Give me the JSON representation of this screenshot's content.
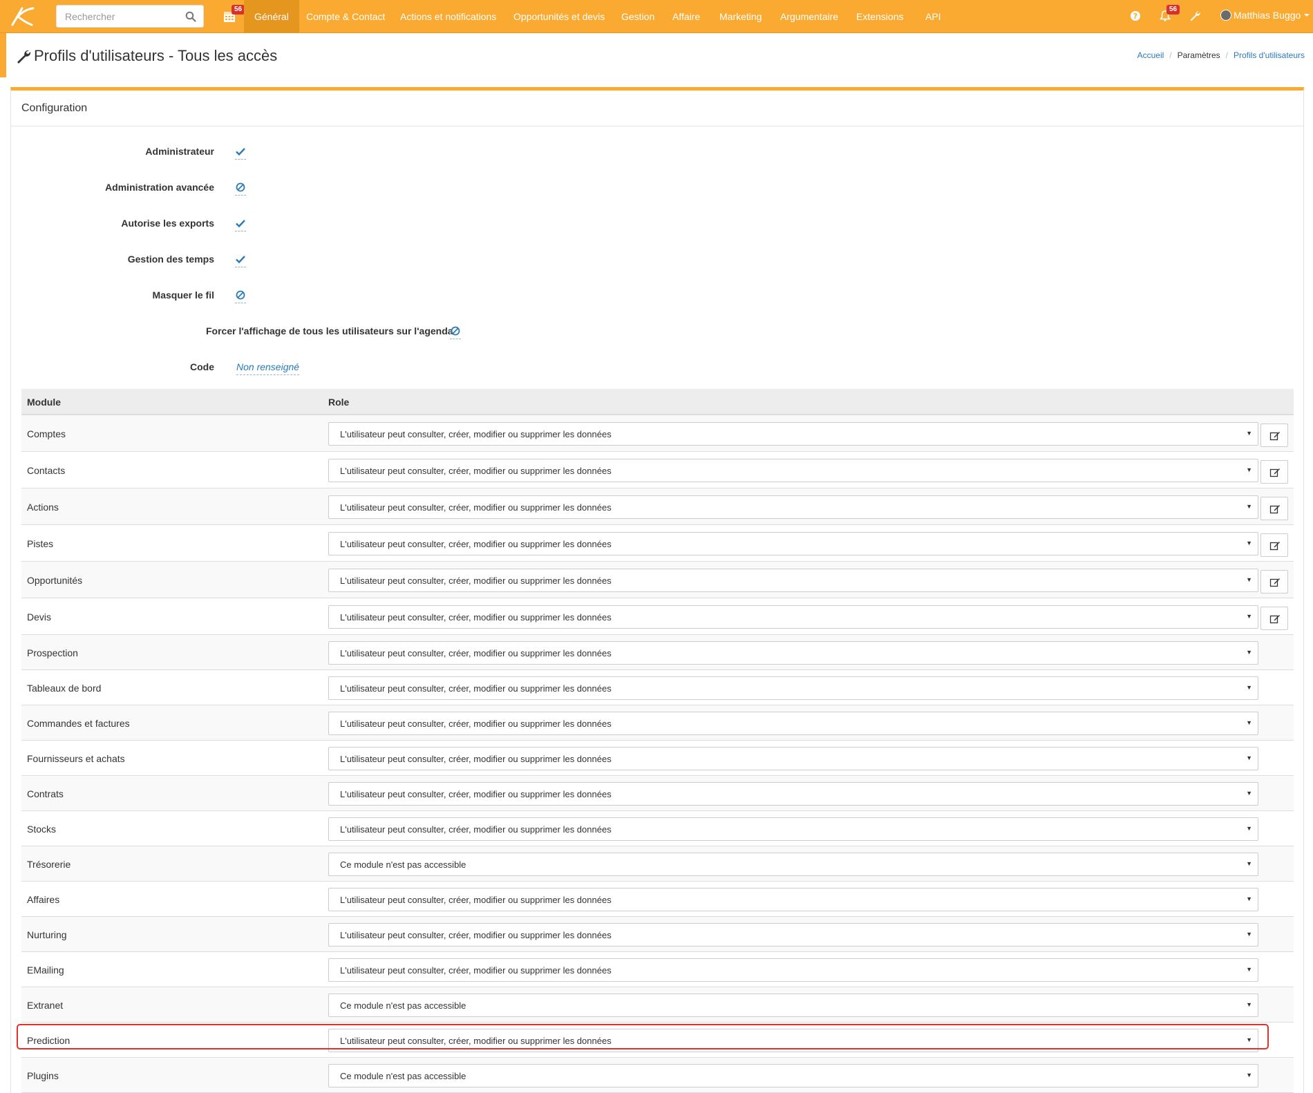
{
  "search": {
    "placeholder": "Rechercher"
  },
  "topbar": {
    "calendar_badge": "56",
    "notifications_badge": "56",
    "nav": [
      {
        "label": "Général",
        "active": true
      },
      {
        "label": "Compte & Contact"
      },
      {
        "label": "Actions et notifications"
      },
      {
        "label": "Opportunités et devis"
      },
      {
        "label": "Gestion"
      },
      {
        "label": "Affaire"
      },
      {
        "label": "Marketing"
      },
      {
        "label": "Argumentaire"
      },
      {
        "label": "Extensions"
      },
      {
        "label": "API"
      }
    ],
    "user_name": "Matthias Buggo"
  },
  "page": {
    "title": "Profils d'utilisateurs - Tous les accès",
    "breadcrumb": [
      "Accueil",
      "Paramètres",
      "Profils d'utilisateurs"
    ]
  },
  "panel": {
    "title": "Configuration",
    "settings": [
      {
        "label": "Administrateur",
        "value": "check-icon"
      },
      {
        "label": "Administration avancée",
        "value": "ban-icon"
      },
      {
        "label": "Autorise les exports",
        "value": "check-icon"
      },
      {
        "label": "Gestion des temps",
        "value": "check-icon"
      },
      {
        "label": "Masquer le fil",
        "value": "ban-icon"
      },
      {
        "label": "Forcer l'affichage de tous les utilisateurs sur l'agenda",
        "value": "ban-icon"
      },
      {
        "label": "Code",
        "value": "Non renseigné"
      }
    ]
  },
  "table": {
    "headers": [
      "Module",
      "Role"
    ],
    "rows": [
      {
        "module": "Comptes",
        "role": "L'utilisateur peut consulter, créer, modifier ou supprimer les données"
      },
      {
        "module": "Contacts",
        "role": "L'utilisateur peut consulter, créer, modifier ou supprimer les données"
      },
      {
        "module": "Actions",
        "role": "L'utilisateur peut consulter, créer, modifier ou supprimer les données"
      },
      {
        "module": "Pistes",
        "role": "L'utilisateur peut consulter, créer, modifier ou supprimer les données"
      },
      {
        "module": "Opportunités",
        "role": "L'utilisateur peut consulter, créer, modifier ou supprimer les données"
      },
      {
        "module": "Devis",
        "role": "L'utilisateur peut consulter, créer, modifier ou supprimer les données"
      },
      {
        "module": "Prospection",
        "role": "L'utilisateur peut consulter, créer, modifier ou supprimer les données"
      },
      {
        "module": "Tableaux de bord",
        "role": "L'utilisateur peut consulter, créer, modifier ou supprimer les données"
      },
      {
        "module": "Commandes et factures",
        "role": "L'utilisateur peut consulter, créer, modifier ou supprimer les données"
      },
      {
        "module": "Fournisseurs et achats",
        "role": "L'utilisateur peut consulter, créer, modifier ou supprimer les données"
      },
      {
        "module": "Contrats",
        "role": "L'utilisateur peut consulter, créer, modifier ou supprimer les données"
      },
      {
        "module": "Stocks",
        "role": "L'utilisateur peut consulter, créer, modifier ou supprimer les données"
      },
      {
        "module": "Trésorerie",
        "role": "Ce module n'est pas accessible"
      },
      {
        "module": "Affaires",
        "role": "L'utilisateur peut consulter, créer, modifier ou supprimer les données"
      },
      {
        "module": "Nurturing",
        "role": "L'utilisateur peut consulter, créer, modifier ou supprimer les données"
      },
      {
        "module": "EMailing",
        "role": "L'utilisateur peut consulter, créer, modifier ou supprimer les données"
      },
      {
        "module": "Extranet",
        "role": "Ce module n'est pas accessible"
      },
      {
        "module": "Prediction",
        "role": "L'utilisateur peut consulter, créer, modifier ou supprimer les données"
      },
      {
        "module": "Plugins",
        "role": "Ce module n'est pas accessible"
      }
    ]
  },
  "colors": {
    "brand": "#fbaa31",
    "link": "#2a7ab8",
    "highlight": "#e0302b",
    "badge": "#d9302b"
  }
}
